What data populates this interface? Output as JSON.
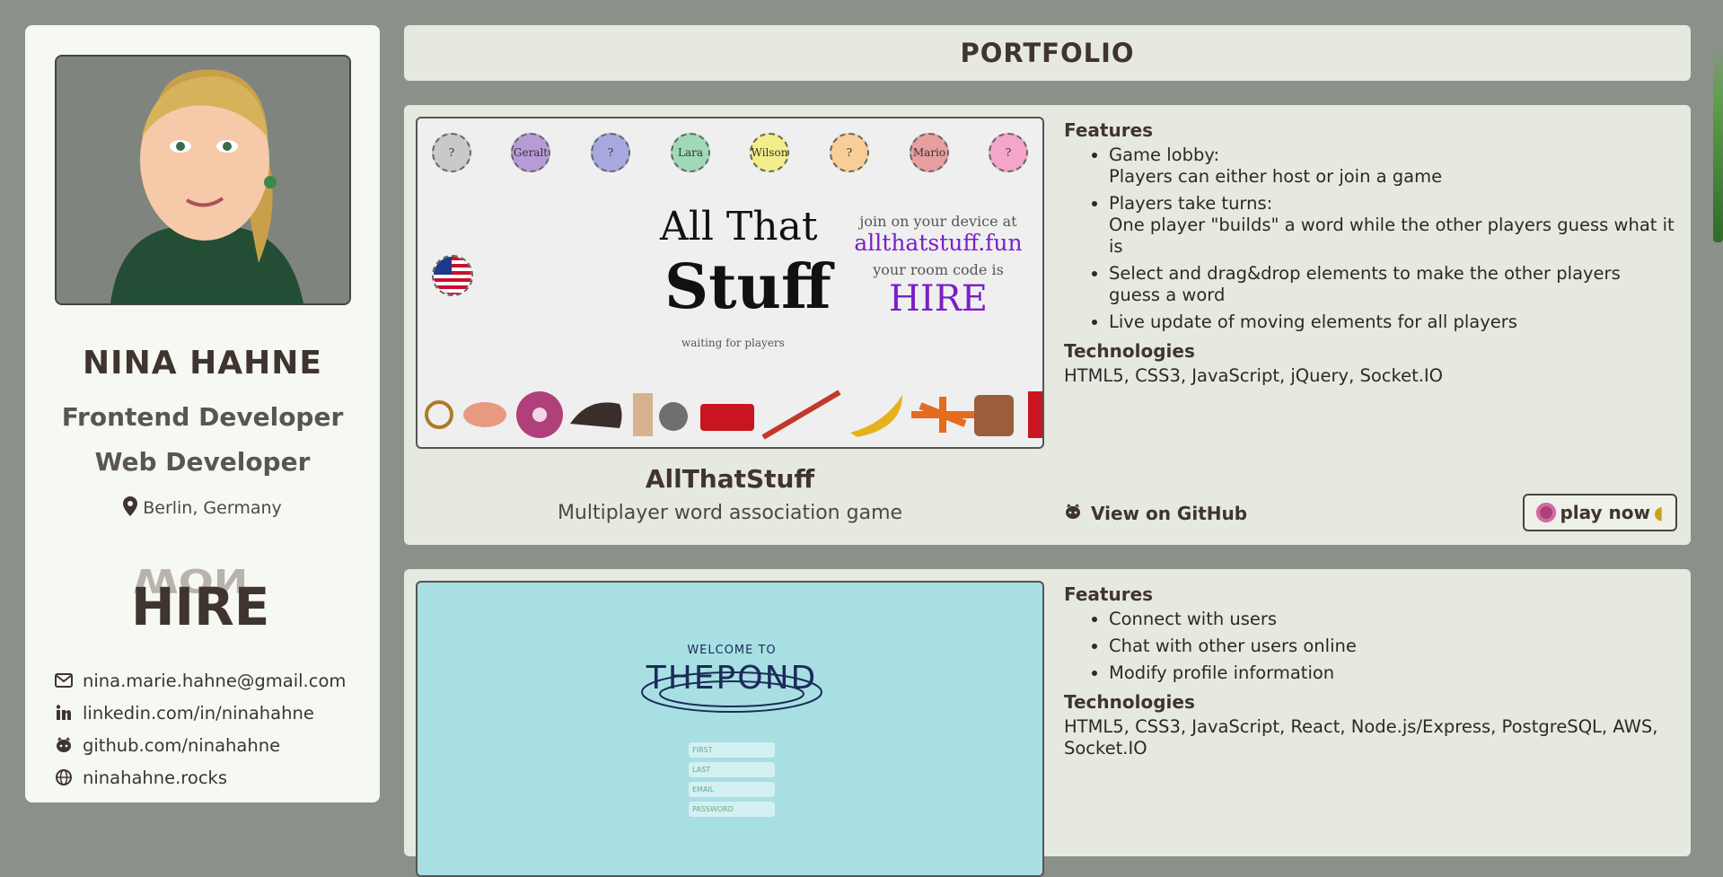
{
  "sidebar": {
    "name": "NINA HAHNE",
    "role1": "Frontend Developer",
    "role2": "Web Developer",
    "location": "Berlin, Germany",
    "contacts": [
      {
        "icon": "mail-icon",
        "text": "nina.marie.hahne@gmail.com"
      },
      {
        "icon": "linkedin-icon",
        "text": "linkedin.com/in/ninahahne"
      },
      {
        "icon": "github-icon",
        "text": "github.com/ninahahne"
      },
      {
        "icon": "globe-icon",
        "text": "ninahahne.rocks"
      }
    ]
  },
  "header": {
    "title": "PORTFOLIO"
  },
  "projects": [
    {
      "title": "AllThatStuff",
      "description": "Multiplayer word association game",
      "features_label": "Features",
      "features": [
        {
          "line1": "Game lobby:",
          "line2": "Players can either host or join a game"
        },
        {
          "line1": "Players take turns:",
          "line2": "One player \"builds\" a word while the other players guess what it is"
        },
        {
          "line1": "Select and drag&drop elements to make the other players guess a word",
          "line2": ""
        },
        {
          "line1": "Live update of moving elements for all players",
          "line2": ""
        }
      ],
      "technologies_label": "Technologies",
      "technologies": "HTML5, CSS3, JavaScript, jQuery, Socket.IO",
      "github_label": "View on GitHub",
      "play_label": "play now",
      "screenshot": {
        "players": [
          "?",
          "Geralt",
          "?",
          "Lara",
          "Wilson",
          "?",
          "Mario",
          "?"
        ],
        "title_line1": "All That",
        "title_line2": "Stuff",
        "waiting": "waiting for players",
        "join_text": "join on your device at",
        "url": "allthatstuff.fun",
        "room_text": "your room code is",
        "room_code": "HIRE"
      }
    },
    {
      "features_label": "Features",
      "features": [
        {
          "line1": "Connect with users",
          "line2": ""
        },
        {
          "line1": "Chat with other users online",
          "line2": ""
        },
        {
          "line1": "Modify profile information",
          "line2": ""
        }
      ],
      "technologies_label": "Technologies",
      "technologies": "HTML5, CSS3, JavaScript, React, Node.js/Express, PostgreSQL, AWS, Socket.IO",
      "screenshot": {
        "welcome": "WELCOME TO",
        "title": "THEPOND",
        "fields": [
          "FIRST",
          "LAST",
          "EMAIL",
          "PASSWORD"
        ]
      }
    }
  ],
  "colors": {
    "background": "#8a9189",
    "panel": "#e6e9e0",
    "sidebar": "#f6f8f2",
    "accent_purple": "#7a1fc6",
    "text": "#3f3430"
  }
}
